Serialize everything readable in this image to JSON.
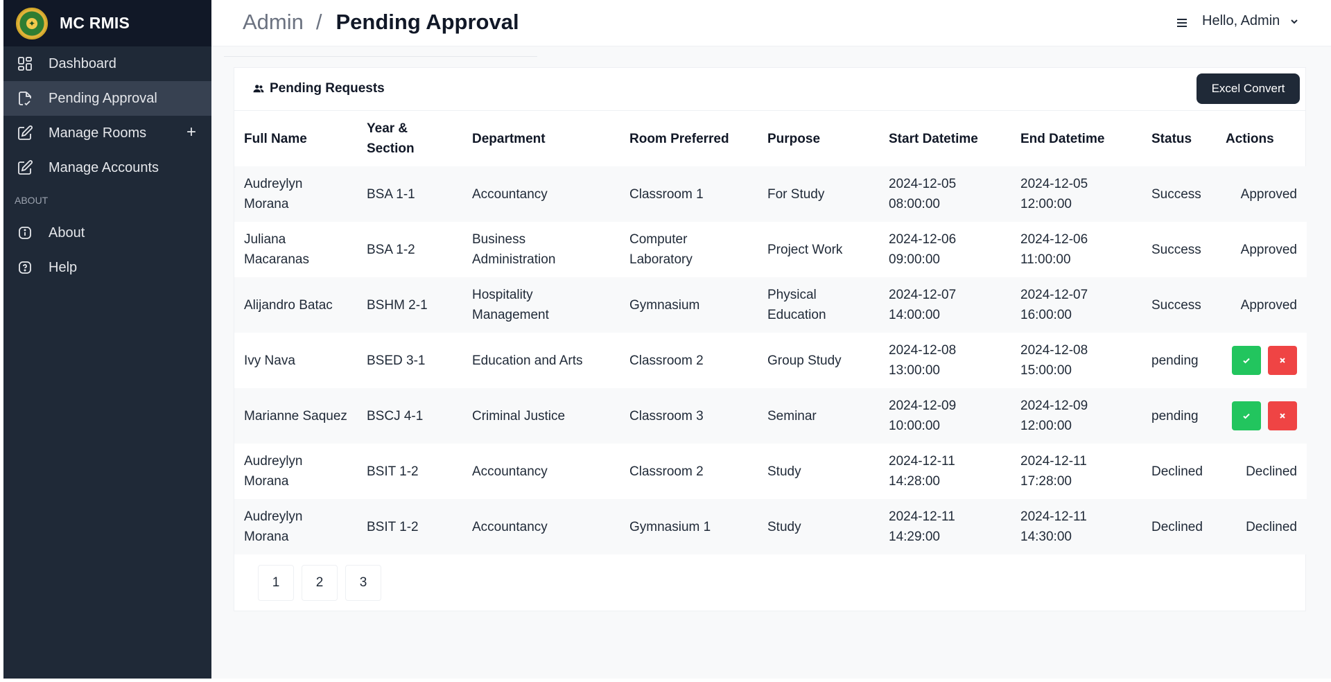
{
  "sidebar": {
    "brand": "MC RMIS",
    "items": [
      {
        "label": "Dashboard"
      },
      {
        "label": "Pending Approval"
      },
      {
        "label": "Manage Rooms"
      },
      {
        "label": "Manage Accounts"
      }
    ],
    "section_about": "ABOUT",
    "about_items": [
      {
        "label": "About"
      },
      {
        "label": "Help"
      }
    ]
  },
  "header": {
    "breadcrumb_root": "Admin",
    "breadcrumb_sep": "/",
    "breadcrumb_current": "Pending Approval",
    "user_greeting": "Hello, Admin"
  },
  "card": {
    "title": "Pending Requests",
    "excel_label": "Excel Convert"
  },
  "table": {
    "headers": {
      "full_name": "Full Name",
      "year_section": "Year & Section",
      "department": "Department",
      "room": "Room Preferred",
      "purpose": "Purpose",
      "start": "Start Datetime",
      "end": "End Datetime",
      "status": "Status",
      "actions": "Actions"
    },
    "rows": [
      {
        "name": "Audreylyn Morana",
        "section": "BSA 1-1",
        "department": "Accountancy",
        "room": "Classroom 1",
        "purpose": "For Study",
        "start": "2024-12-05 08:00:00",
        "end": "2024-12-05 12:00:00",
        "status": "Success",
        "action": "Approved"
      },
      {
        "name": "Juliana Macaranas",
        "section": "BSA 1-2",
        "department": "Business Administration",
        "room": "Computer Laboratory",
        "purpose": "Project Work",
        "start": "2024-12-06 09:00:00",
        "end": "2024-12-06 11:00:00",
        "status": "Success",
        "action": "Approved"
      },
      {
        "name": "Alijandro Batac",
        "section": "BSHM 2-1",
        "department": "Hospitality Management",
        "room": "Gymnasium",
        "purpose": "Physical Education",
        "start": "2024-12-07 14:00:00",
        "end": "2024-12-07 16:00:00",
        "status": "Success",
        "action": "Approved"
      },
      {
        "name": "Ivy Nava",
        "section": "BSED 3-1",
        "department": "Education and Arts",
        "room": "Classroom 2",
        "purpose": "Group Study",
        "start": "2024-12-08 13:00:00",
        "end": "2024-12-08 15:00:00",
        "status": "pending",
        "action": ""
      },
      {
        "name": "Marianne Saquez",
        "section": "BSCJ 4-1",
        "department": "Criminal Justice",
        "room": "Classroom 3",
        "purpose": "Seminar",
        "start": "2024-12-09 10:00:00",
        "end": "2024-12-09 12:00:00",
        "status": "pending",
        "action": ""
      },
      {
        "name": "Audreylyn Morana",
        "section": "BSIT 1-2",
        "department": "Accountancy",
        "room": "Classroom 2",
        "purpose": "Study",
        "start": "2024-12-11 14:28:00",
        "end": "2024-12-11 17:28:00",
        "status": "Declined",
        "action": "Declined"
      },
      {
        "name": "Audreylyn Morana",
        "section": "BSIT 1-2",
        "department": "Accountancy",
        "room": "Gymnasium 1",
        "purpose": "Study",
        "start": "2024-12-11 14:29:00",
        "end": "2024-12-11 14:30:00",
        "status": "Declined",
        "action": "Declined"
      }
    ]
  },
  "pagination": {
    "pages": [
      "1",
      "2",
      "3"
    ]
  },
  "colors": {
    "sidebar_bg": "#1f2937",
    "brand_bg": "#111827",
    "approve": "#22c55e",
    "decline": "#ef4444"
  }
}
